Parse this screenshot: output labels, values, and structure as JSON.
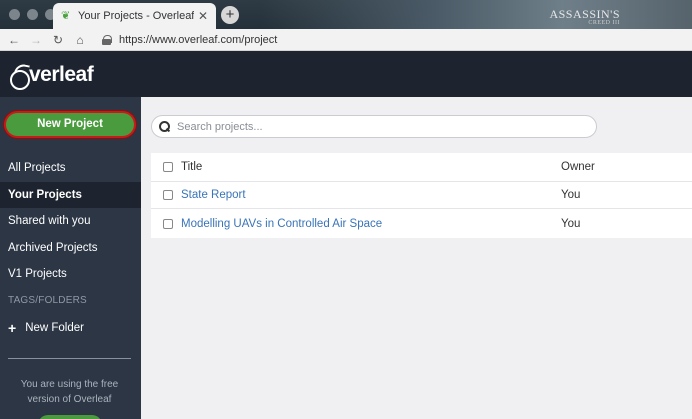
{
  "browser": {
    "tab_title": "Your Projects - Overleaf, Onlin",
    "tab_close": "✕",
    "new_tab": "+",
    "url": "https://www.overleaf.com/project",
    "tabbar_art_text": "ASSASSIN'S",
    "tabbar_art_subtext": "CREED III"
  },
  "header": {
    "logo_text": "verleaf"
  },
  "sidebar": {
    "new_project_label": "New Project",
    "items": [
      {
        "label": "All Projects",
        "active": false
      },
      {
        "label": "Your Projects",
        "active": true
      },
      {
        "label": "Shared with you",
        "active": false
      },
      {
        "label": "Archived Projects",
        "active": false
      },
      {
        "label": "V1 Projects",
        "active": false
      }
    ],
    "tags_label": "TAGS/FOLDERS",
    "new_folder_label": "New Folder",
    "free_note": "You are using the free version of Overleaf"
  },
  "search": {
    "placeholder": "Search projects..."
  },
  "table": {
    "columns": {
      "title": "Title",
      "owner": "Owner"
    },
    "rows": [
      {
        "title": "State Report",
        "owner": "You"
      },
      {
        "title": "Modelling UAVs in Controlled Air Space",
        "owner": "You"
      }
    ]
  },
  "colors": {
    "header_bg": "#1d2430",
    "sidebar_bg": "#2c3645",
    "new_project_green": "#4a9b3e",
    "highlight_red": "#c41b1b",
    "link_blue": "#3a74b8"
  }
}
